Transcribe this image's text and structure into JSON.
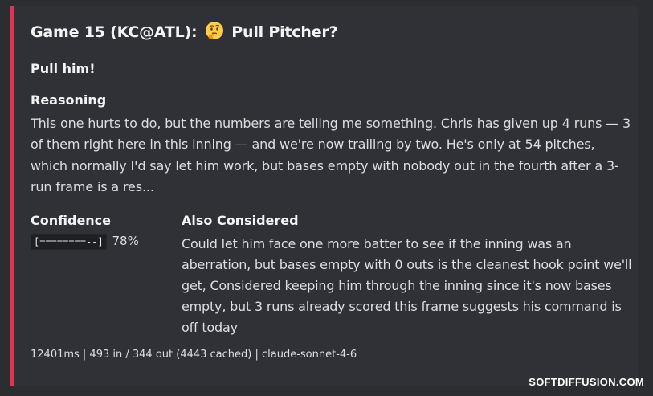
{
  "embed": {
    "accent_color": "#e03450",
    "title_prefix": "Game 15 (KC@ATL):",
    "title_emoji": "thinking-face-icon",
    "title_suffix": "Pull Pitcher?",
    "verdict": "Pull him!",
    "reasoning_label": "Reasoning",
    "reasoning_text": "This one hurts to do, but the numbers are telling me something. Chris has given up 4 runs — 3 of them right here in this inning — and we're now trailing by two. He's only at 54 pitches, which normally I'd say let him work, but bases empty with nobody out in the fourth after a 3-run frame is a res...",
    "confidence_label": "Confidence",
    "confidence_bar": "[========--]",
    "confidence_value": "78%",
    "also_label": "Also Considered",
    "also_text": "Could let him face one more batter to see if the inning was an aberration, but bases empty with 0 outs is the cleanest hook point we'll get, Considered keeping him through the inning since it's now bases empty, but 3 runs already scored this frame suggests his command is off today",
    "footer": "12401ms | 493 in / 344 out (4443 cached) | claude-sonnet-4-6"
  },
  "watermark": "SOFTDIFFUSION.COM"
}
